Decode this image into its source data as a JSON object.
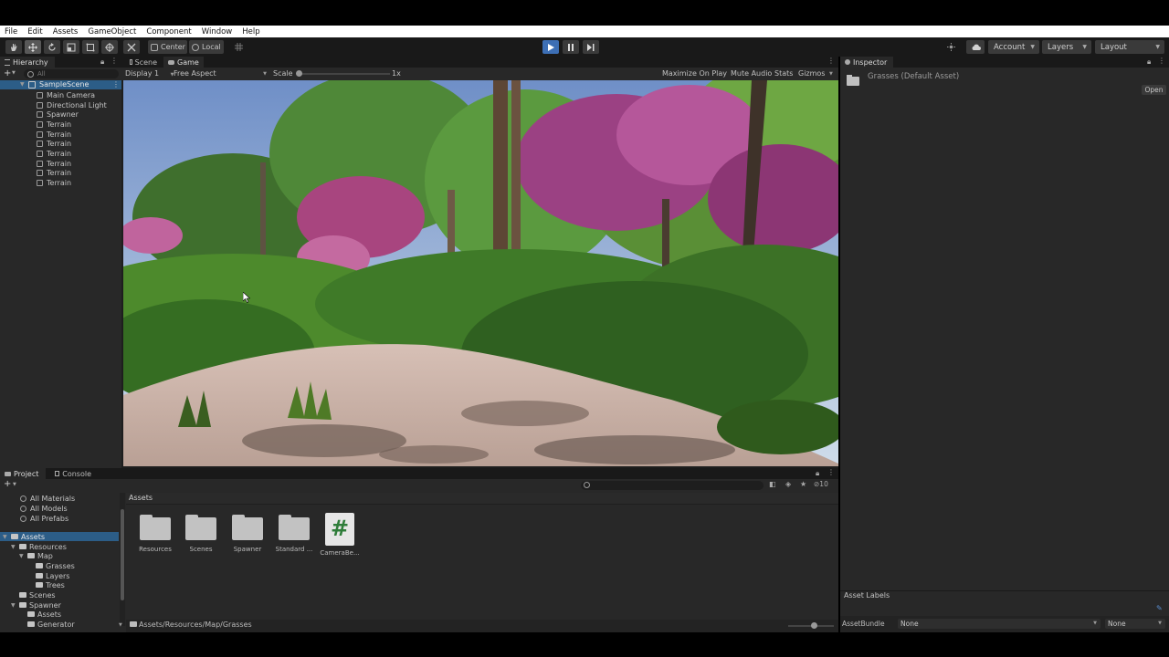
{
  "menu": [
    "File",
    "Edit",
    "Assets",
    "GameObject",
    "Component",
    "Window",
    "Help"
  ],
  "toolbar": {
    "tools": [
      "hand",
      "move",
      "rotate",
      "scale",
      "rect",
      "transform",
      "custom"
    ],
    "pivot": "Center",
    "space": "Local",
    "account": "Account",
    "layers": "Layers",
    "layout": "Layout"
  },
  "hierarchy": {
    "tab": "Hierarchy",
    "search_placeholder": "All",
    "scene": "SampleScene",
    "items": [
      "Main Camera",
      "Directional Light",
      "Spawner",
      "Terrain",
      "Terrain",
      "Terrain",
      "Terrain",
      "Terrain",
      "Terrain",
      "Terrain"
    ]
  },
  "view": {
    "tabs": [
      "Scene",
      "Game"
    ],
    "display": "Display 1",
    "aspect": "Free Aspect",
    "scale_label": "Scale",
    "scale_value": "1x",
    "options": [
      "Maximize On Play",
      "Mute Audio",
      "Stats",
      "Gizmos"
    ]
  },
  "inspector": {
    "tab": "Inspector",
    "title": "Grasses (Default Asset)",
    "open": "Open",
    "asset_labels": "Asset Labels",
    "asset_bundle_label": "AssetBundle",
    "asset_bundle_value": "None",
    "asset_variant_value": "None"
  },
  "project": {
    "tabs": [
      "Project",
      "Console"
    ],
    "favorites": [
      "All Materials",
      "All Models",
      "All Prefabs"
    ],
    "tree": [
      {
        "label": "Assets",
        "depth": 0
      },
      {
        "label": "Resources",
        "depth": 1
      },
      {
        "label": "Map",
        "depth": 2
      },
      {
        "label": "Grasses",
        "depth": 3
      },
      {
        "label": "Layers",
        "depth": 3
      },
      {
        "label": "Trees",
        "depth": 3
      },
      {
        "label": "Scenes",
        "depth": 1
      },
      {
        "label": "Spawner",
        "depth": 1
      },
      {
        "label": "Assets",
        "depth": 2
      },
      {
        "label": "Generator",
        "depth": 2
      }
    ],
    "header": "Assets",
    "hidden_count": "10",
    "items": [
      "Resources",
      "Scenes",
      "Spawner",
      "Standard ...",
      "CameraBe..."
    ],
    "script_glyph": "#",
    "path": "Assets/Resources/Map/Grasses"
  },
  "colors": {
    "panel": "#282828",
    "tab_bar": "#191919",
    "accent": "#3a72b0",
    "play_active": "#3d6fb5",
    "script_green": "#2f7d3a"
  }
}
